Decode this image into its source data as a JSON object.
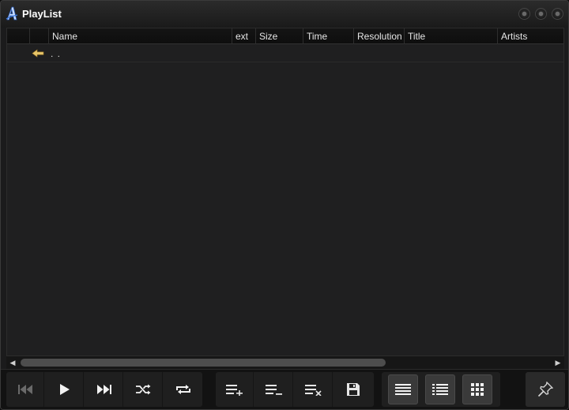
{
  "window": {
    "title": "PlayList",
    "logo": "app-logo-a-icon",
    "controls": [
      "minimize-icon",
      "maximize-icon",
      "close-icon"
    ]
  },
  "columns": [
    "Name",
    "ext",
    "Size",
    "Time",
    "Resolution",
    "Title",
    "Artists"
  ],
  "rows": [
    {
      "icon": "parent-folder-arrow-icon",
      "name": ". ."
    }
  ],
  "toolbar": {
    "playback": [
      "previous-icon",
      "play-icon",
      "next-icon",
      "shuffle-icon",
      "repeat-icon"
    ],
    "list": [
      "add-to-list-icon",
      "remove-from-list-icon",
      "clear-list-icon",
      "save-icon"
    ],
    "views": [
      "list-view-icon",
      "detail-view-icon",
      "thumbnail-view-icon"
    ],
    "pin": "pin-icon"
  },
  "colors": {
    "background": "#1b1b1c",
    "text": "#e6e6e6",
    "accent": "#e8c66a"
  }
}
